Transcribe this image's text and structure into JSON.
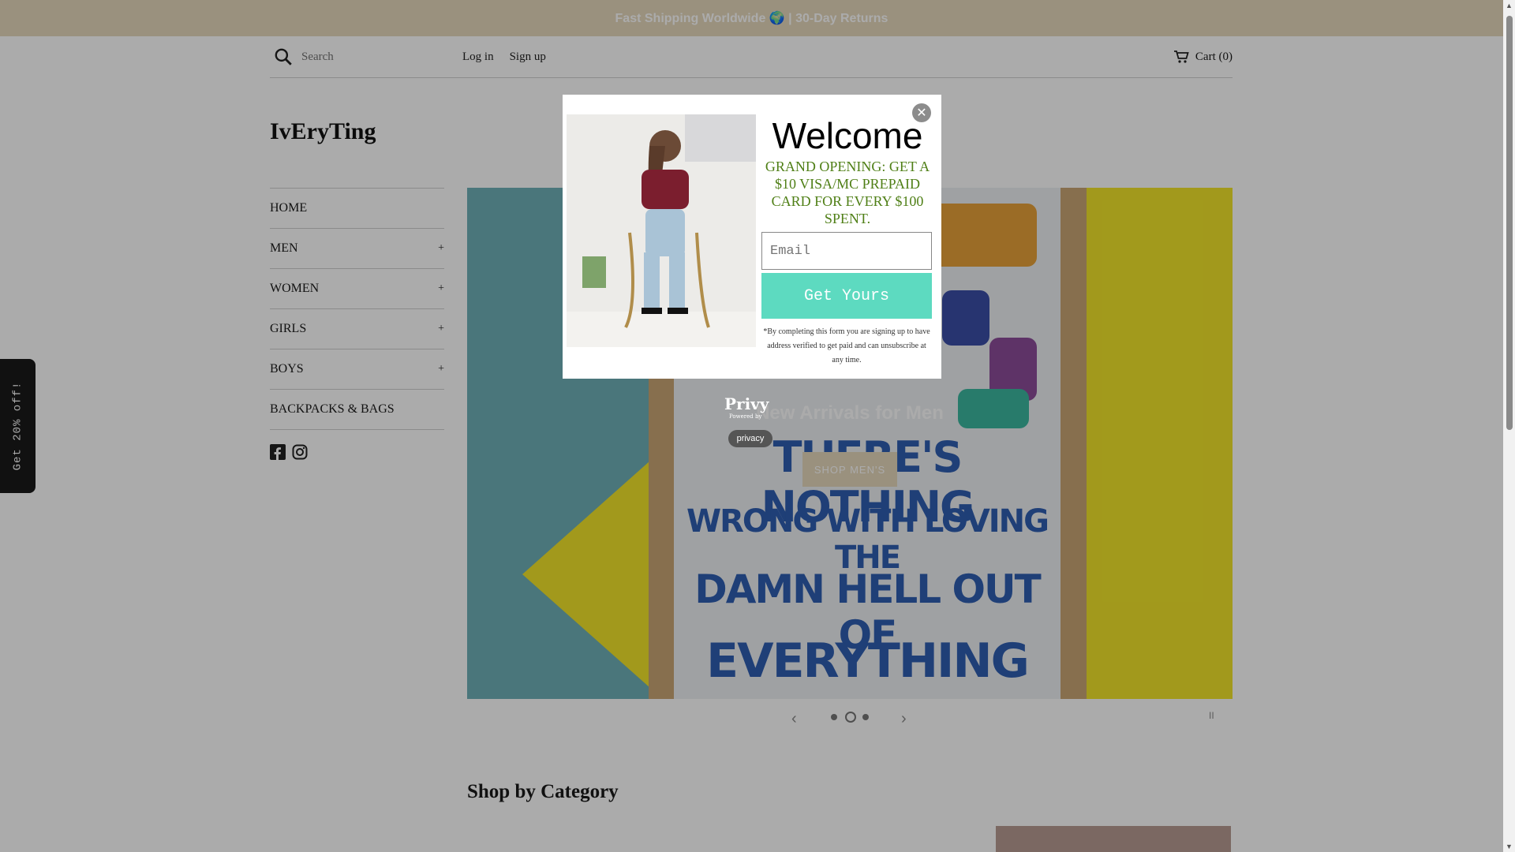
{
  "announcement": "Fast Shipping Worldwide 🌍 | 30-Day Returns",
  "header": {
    "search_placeholder": "Search",
    "login": "Log in",
    "signup": "Sign up",
    "cart": "Cart (0)"
  },
  "store_name": "IvEryTing",
  "nav": [
    {
      "label": "HOME",
      "expandable": false
    },
    {
      "label": "MEN",
      "expandable": true
    },
    {
      "label": "WOMEN",
      "expandable": true
    },
    {
      "label": "GIRLS",
      "expandable": true
    },
    {
      "label": "BOYS",
      "expandable": true
    },
    {
      "label": "BACKPACKS & BAGS",
      "expandable": false
    }
  ],
  "nav_expand_symbol": "+",
  "social": [
    "facebook-icon",
    "instagram-icon"
  ],
  "hero": {
    "title": "New Arrivals for Men",
    "button": "SHOP MEN'S",
    "poster_lines": [
      "THERE'S NOTHING",
      "WRONG WITH LOVING THE",
      "DAMN HELL OUT OF",
      "EVERYTHING"
    ],
    "slides_total": 3,
    "active_slide": 2,
    "prev": "‹",
    "next": "›",
    "pause": "II"
  },
  "section_title": "Shop by Category",
  "side_tab": "Get 20% off!",
  "modal": {
    "close": "✕",
    "heading": "Welcome",
    "promo": "GRAND OPENING: GET A $10 VISA/MC PREPAID CARD FOR EVERY $100 SPENT.",
    "email_placeholder": "Email",
    "button": "Get Yours",
    "disclaimer": "*By completing this form you are signing up to have address verified to get paid and can unsubscribe at any time."
  },
  "privy": {
    "logo": "Privy",
    "powered": "Powered by",
    "privacy": "privacy"
  },
  "colors": {
    "announcement_bg": "#e6d8bd",
    "cta": "#5ddac0",
    "promo_text": "#4f7f16"
  }
}
